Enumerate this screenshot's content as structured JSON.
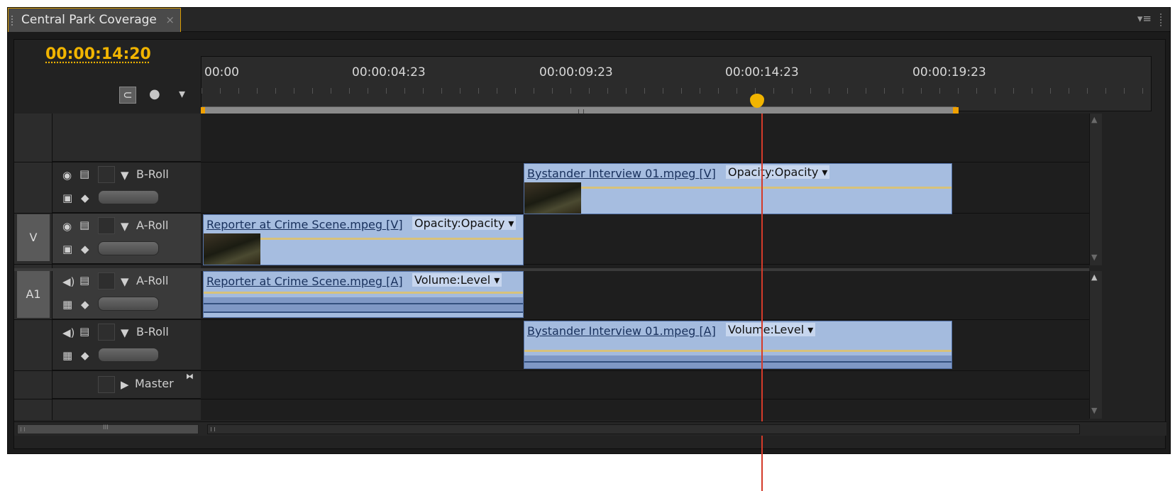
{
  "tab": {
    "title": "Central Park Coverage",
    "close": "×"
  },
  "panel_menu": "▾≡",
  "timecode": "00:00:14:20",
  "ruler": {
    "labels": [
      "00:00",
      "00:00:04:23",
      "00:00:09:23",
      "00:00:14:23",
      "00:00:19:23"
    ]
  },
  "work_area_grip": "III",
  "tracks": {
    "v_source": "V",
    "a_source": "A1",
    "v2": {
      "name": "B-Roll"
    },
    "v1": {
      "name": "A-Roll"
    },
    "a1": {
      "name": "A-Roll"
    },
    "a2": {
      "name": "B-Roll"
    },
    "master": {
      "name": "Master"
    }
  },
  "clips": {
    "v2": {
      "name": "Bystander Interview 01.mpeg",
      "tag": "[V]",
      "fx": "Opacity:Opacity"
    },
    "v1": {
      "name": "Reporter at Crime Scene.mpeg",
      "tag": "[V]",
      "fx": "Opacity:Opacity"
    },
    "a1": {
      "name": "Reporter at Crime Scene.mpeg",
      "tag": "[A]",
      "fx": "Volume:Level"
    },
    "a2": {
      "name": "Bystander Interview 01.mpeg",
      "tag": "[A]",
      "fx": "Volume:Level"
    }
  },
  "hscroll_grip": "III",
  "playhead_time": "00:00:14:20"
}
